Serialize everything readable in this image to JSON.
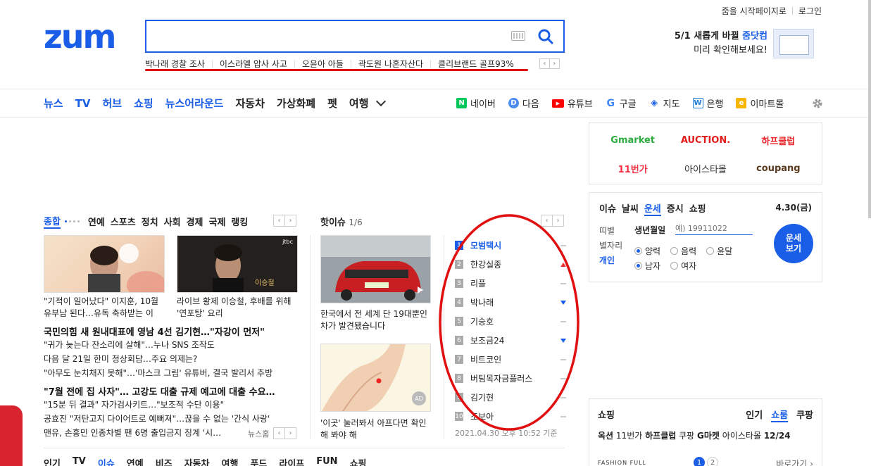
{
  "top_links": {
    "start_page": "줌을 시작페이지로",
    "login": "로그인"
  },
  "logo": "zum",
  "search": {
    "value": "",
    "placeholder": ""
  },
  "trending": [
    "박나래 경찰 조사",
    "이스라엘 압사 사고",
    "오윤아 아들",
    "곽도원 나혼자산다",
    "클리브랜드 골프93%"
  ],
  "promo": {
    "line1_a": "5/1 새롭게 바뀔 ",
    "line1_b": "줌닷컴",
    "line2": "미리 확인해보세요!"
  },
  "nav": {
    "items": [
      "뉴스",
      "TV",
      "허브",
      "쇼핑",
      "뉴스어라운드",
      "자동차",
      "가상화폐",
      "펫",
      "여행"
    ],
    "services": [
      {
        "label": "네이버",
        "icon": "naver-icon",
        "color": "#03c75a",
        "glyph": "N"
      },
      {
        "label": "다음",
        "icon": "daum-icon",
        "color": "#4a8cf0",
        "glyph": "D"
      },
      {
        "label": "유튜브",
        "icon": "youtube-icon",
        "color": "#ff0000",
        "glyph": "▶"
      },
      {
        "label": "구글",
        "icon": "google-icon",
        "color": "#4285f4",
        "glyph": "G"
      },
      {
        "label": "지도",
        "icon": "map-icon",
        "color": "#1a5ee8",
        "glyph": "◆"
      },
      {
        "label": "은행",
        "icon": "bank-icon",
        "color": "#1a7ad8",
        "glyph": "W"
      },
      {
        "label": "이마트몰",
        "icon": "emart-icon",
        "color": "#f7b500",
        "glyph": "e"
      }
    ]
  },
  "shops": [
    {
      "label": "Gmarket",
      "color": "#2dac3f"
    },
    {
      "label": "AUCTION.",
      "color": "#e21b1b"
    },
    {
      "label": "하프클럽",
      "color": "#e8262a"
    },
    {
      "label": "11번가",
      "color": "#f43142"
    },
    {
      "label": "아이스타몰",
      "color": "#333333"
    },
    {
      "label": "coupang",
      "color": "#5a3a1f"
    }
  ],
  "info": {
    "tabs": [
      "이슈",
      "날씨",
      "운세",
      "증시",
      "쇼핑"
    ],
    "active_tab": "운세",
    "date": "4.30(금)",
    "label_birth": "띠별",
    "label_zodiac": "별자리",
    "label_personal": "개인",
    "birth_label": "생년월일",
    "birth_placeholder": "예) 19911022",
    "cal_solar": "양력",
    "cal_lunar": "음력",
    "cal_leap": "윤달",
    "sex_male": "남자",
    "sex_female": "여자",
    "button_line1": "운세",
    "button_line2": "보기"
  },
  "news": {
    "categories": [
      "종합",
      "연예",
      "스포츠",
      "정치",
      "사회",
      "경제",
      "국제",
      "랭킹"
    ],
    "thumb1_caption": "\"기적이 일어났다\" 이지훈, 10월 유부남 된다…유독 축하받는 이",
    "thumb2_caption": "라이브 황제 이승철, 후배를 위해 '연포탕' 요리",
    "thumb2_overlay": "jtbc",
    "headline1": "국민의힘 새 원내대표에 영남 4선 김기현…\"자강이 먼저\"",
    "subs1": [
      "\"귀가 늦는다 잔소리에 살해\"…누나 SNS 조작도",
      "다음 달 21일 한미 정상회담…주요 의제는?",
      "\"아무도 눈치채지 못해\"…'마스크 그림' 유튜버, 결국 발리서 추방"
    ],
    "headline2": "\"7월 전에 집 사자\"… 고강도 대출 규제 예고에 대출 수요…",
    "subs2": [
      "\"15분 뒤 결과\" 자가검사키트…\"보조적 수단 이용\"",
      "공효진 \"저탄고지 다이어트로 예뻐져\"…끊을 수 없는 '간식 사랑'",
      "맨유, 손흥민 인종차별 팬 6명 출입금지 징계 '시…"
    ],
    "source": "뉴스홈"
  },
  "hot": {
    "title": "핫이슈",
    "count": "1/6",
    "car_caption": "한국에서 전 세계 단 19대뿐인 차가 발견됐습니다",
    "ad_caption": "'이곳' 눌러봐서 아프다면 확인해 봐야 해",
    "ad_badge": "AD"
  },
  "ranking": {
    "items": [
      {
        "num": "1",
        "label": "모범택시",
        "trend": "same"
      },
      {
        "num": "2",
        "label": "한강실종",
        "trend": "up"
      },
      {
        "num": "3",
        "label": "리플",
        "trend": "same"
      },
      {
        "num": "4",
        "label": "박나래",
        "trend": "down"
      },
      {
        "num": "5",
        "label": "기승호",
        "trend": "same"
      },
      {
        "num": "6",
        "label": "보조금24",
        "trend": "down"
      },
      {
        "num": "7",
        "label": "비트코인",
        "trend": "same"
      },
      {
        "num": "8",
        "label": "버팀목자금플러스",
        "trend": "same"
      },
      {
        "num": "9",
        "label": "김기현",
        "trend": "same"
      },
      {
        "num": "10",
        "label": "조보아",
        "trend": "same"
      }
    ],
    "time": "2021.04.30 오후 10:52 기준"
  },
  "bottom_tabs": [
    "인기",
    "TV",
    "이슈",
    "연예",
    "비즈",
    "자동차",
    "여행",
    "푸드",
    "라이프",
    "FUN",
    "쇼핑"
  ],
  "bottom_active": "이슈",
  "shopping2": {
    "title": "쇼핑",
    "tabs": [
      "인기",
      "쇼룸",
      "쿠팡"
    ],
    "active": "쇼룸",
    "brands": [
      "옥션",
      "11번가",
      "하프클럽",
      "쿠팡",
      "G마켓",
      "아이스타몰"
    ],
    "count": "12/24",
    "pages": [
      "1",
      "2"
    ],
    "more": "바로가기",
    "brand_text": "FASHION FULL"
  }
}
